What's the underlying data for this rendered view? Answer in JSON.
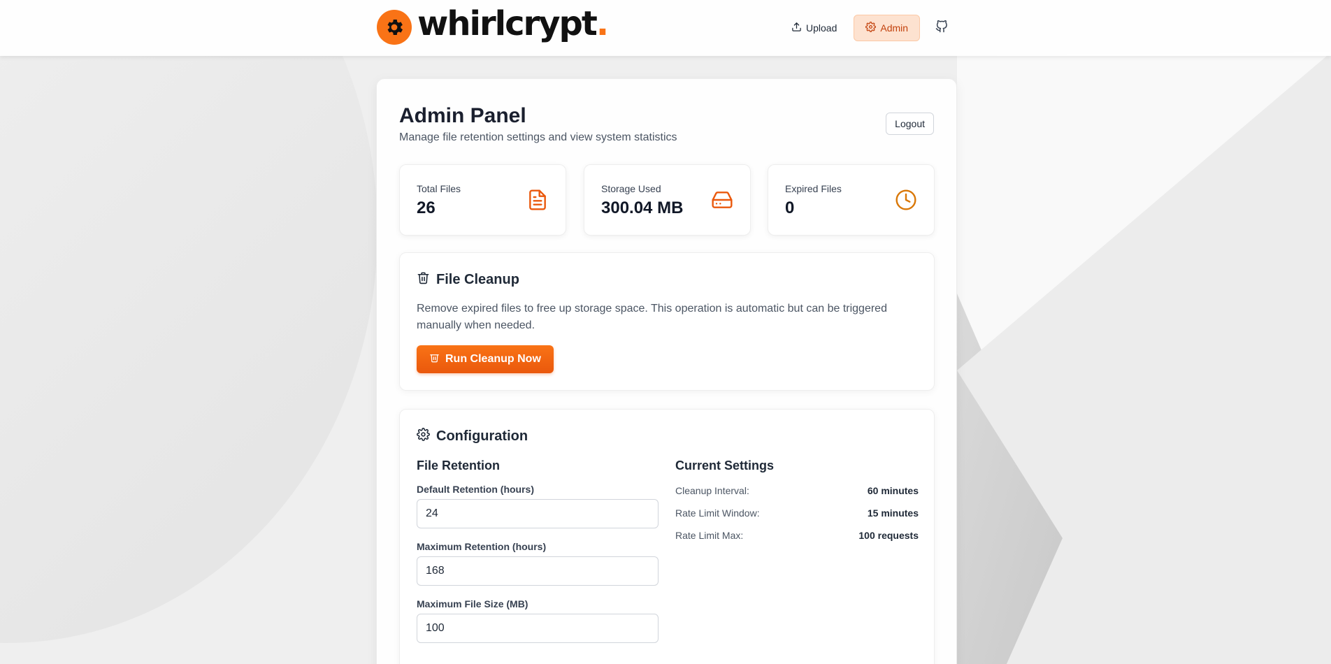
{
  "brand": {
    "name": "whirlcrypt",
    "dot": ".",
    "accent": "#f97316"
  },
  "nav": {
    "upload_label": "Upload",
    "admin_label": "Admin",
    "github_icon": "github-icon"
  },
  "panel": {
    "title": "Admin Panel",
    "subtitle": "Manage file retention settings and view system statistics",
    "logout_label": "Logout"
  },
  "stats": [
    {
      "label": "Total Files",
      "value": "26",
      "icon": "file-text-icon"
    },
    {
      "label": "Storage Used",
      "value": "300.04 MB",
      "icon": "hard-drive-icon"
    },
    {
      "label": "Expired Files",
      "value": "0",
      "icon": "clock-icon"
    }
  ],
  "cleanup": {
    "title": "File Cleanup",
    "description": "Remove expired files to free up storage space. This operation is automatic but can be triggered manually when needed.",
    "button_label": "Run Cleanup Now"
  },
  "config": {
    "title": "Configuration",
    "retention_title": "File Retention",
    "fields": [
      {
        "label": "Default Retention (hours)",
        "value": "24"
      },
      {
        "label": "Maximum Retention (hours)",
        "value": "168"
      },
      {
        "label": "Maximum File Size (MB)",
        "value": "100"
      }
    ],
    "current_title": "Current Settings",
    "settings": [
      {
        "key": "Cleanup Interval:",
        "value": "60 minutes"
      },
      {
        "key": "Rate Limit Window:",
        "value": "15 minutes"
      },
      {
        "key": "Rate Limit Max:",
        "value": "100 requests"
      }
    ]
  }
}
